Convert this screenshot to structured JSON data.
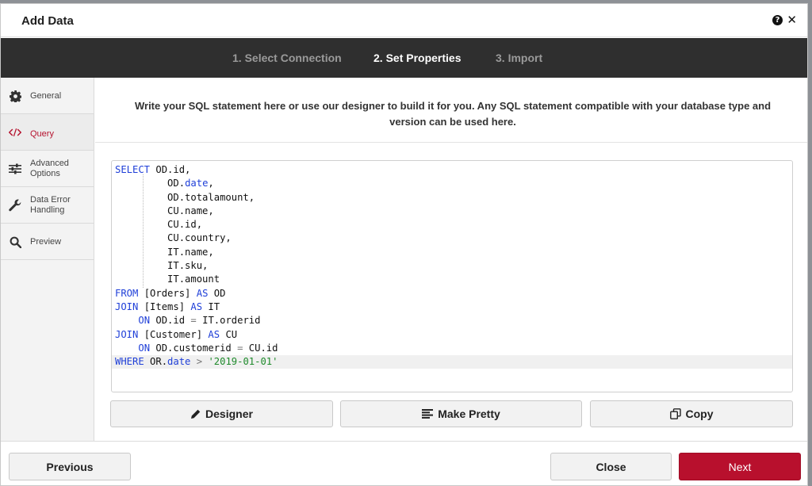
{
  "dialog": {
    "title": "Add Data",
    "help_glyph": "?",
    "close_glyph": "✕"
  },
  "steps": [
    {
      "label": "1. Select Connection",
      "active": false
    },
    {
      "label": "2. Set Properties",
      "active": true
    },
    {
      "label": "3. Import",
      "active": false
    }
  ],
  "sidebar": {
    "items": [
      {
        "label": "General",
        "icon": "gear-icon"
      },
      {
        "label": "Query",
        "icon": "code-icon",
        "active": true
      },
      {
        "label": "Advanced Options",
        "line1": "Advanced",
        "line2": "Options",
        "icon": "sliders-icon"
      },
      {
        "label": "Data Error Handling",
        "line1": "Data Error",
        "line2": "Handling",
        "icon": "wrench-icon"
      },
      {
        "label": "Preview",
        "icon": "search-icon"
      }
    ]
  },
  "instructions": "Write your SQL statement here or use our designer to build it for you. Any SQL statement compatible with your database type and version can be used here.",
  "sql": {
    "lines": [
      "SELECT OD.id,",
      "         OD.date,",
      "         OD.totalamount,",
      "         CU.name,",
      "         CU.id,",
      "         CU.country,",
      "         IT.name,",
      "         IT.sku,",
      "         IT.amount",
      "FROM [Orders] AS OD",
      "JOIN [Items] AS IT",
      "    ON OD.id = IT.orderid",
      "JOIN [Customer] AS CU",
      "    ON OD.customerid = CU.id",
      "WHERE OR.date > '2019-01-01'"
    ]
  },
  "editor_buttons": {
    "designer": "Designer",
    "make_pretty": "Make Pretty",
    "copy": "Copy"
  },
  "footer": {
    "previous": "Previous",
    "close": "Close",
    "next": "Next"
  },
  "colors": {
    "step_bar": "#2f2f2f",
    "accent": "#b8102d",
    "sql_keyword": "#1f3fd8",
    "sql_string": "#1e8a2b"
  }
}
